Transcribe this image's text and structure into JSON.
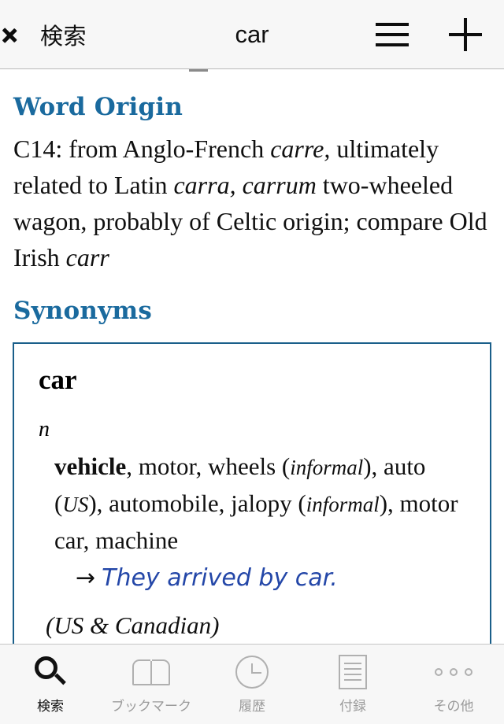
{
  "nav": {
    "back_label": "検索",
    "title": "car",
    "back_icon": "chevron-left-icon",
    "menu_icon": "hamburger-menu-icon",
    "add_icon": "plus-icon"
  },
  "content": {
    "word_origin": {
      "heading": "Word Origin",
      "text_part1": "C14: from Anglo-French ",
      "italic1": "carre,",
      "text_part2": " ultimately related to Latin ",
      "italic2": "carra, carrum",
      "text_part3": " two-wheeled wagon, probably of Celtic origin; compare Old Irish ",
      "italic3": "carr"
    },
    "synonyms": {
      "heading": "Synonyms",
      "entry_word": "car",
      "part_of_speech": "n",
      "syn_bold": "vehicle",
      "syn_rest1": ", motor, wheels (",
      "syn_label1": "informal",
      "syn_rest2": "), auto (",
      "syn_label2": "US",
      "syn_rest3": "), automobile, jalopy (",
      "syn_label3": "informal",
      "syn_rest4": "), motor car, machine",
      "example_arrow": "→",
      "example_text": "They arrived by car.",
      "region_note": "(US & Canadian)"
    }
  },
  "tabs": [
    {
      "label": "検索",
      "icon": "search-icon",
      "active": true
    },
    {
      "label": "ブックマーク",
      "icon": "bookmark-book-icon",
      "active": false
    },
    {
      "label": "履歴",
      "icon": "history-clock-icon",
      "active": false
    },
    {
      "label": "付録",
      "icon": "appendix-document-icon",
      "active": false
    },
    {
      "label": "その他",
      "icon": "more-dots-icon",
      "active": false
    }
  ],
  "colors": {
    "heading_blue": "#1a6a9e",
    "box_border_blue": "#1a5f8a",
    "example_blue": "#2447a8",
    "bar_background": "#f7f7f7",
    "inactive_tab": "#9b9b9b"
  }
}
